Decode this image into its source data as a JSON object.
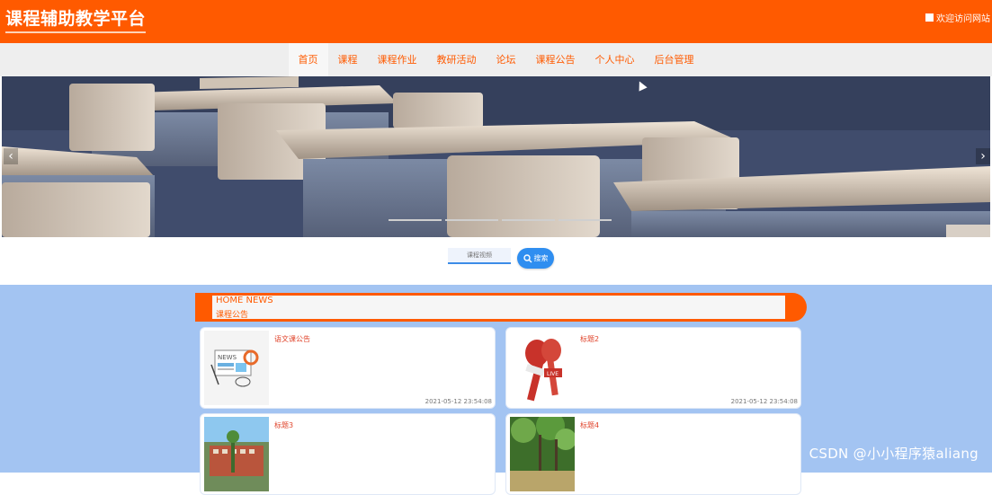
{
  "header": {
    "title": "课程辅助教学平台",
    "welcome": "欢迎访问网站"
  },
  "nav": {
    "items": [
      "首页",
      "课程",
      "课程作业",
      "教研活动",
      "论坛",
      "课程公告",
      "个人中心",
      "后台管理"
    ],
    "active": "首页"
  },
  "banner": {
    "prev_icon": "chevron-left-icon",
    "next_icon": "chevron-right-icon",
    "slides": 4
  },
  "search": {
    "placeholder": "课程视频",
    "button_label": "搜索"
  },
  "news": {
    "heading_en": "HOME NEWS",
    "heading_cn": "课程公告",
    "items": [
      {
        "title": "语文课公告",
        "date": "2021-05-12 23:54:08",
        "thumb": "news-icon"
      },
      {
        "title": "标题2",
        "date": "2021-05-12 23:54:08",
        "thumb": "microphone-icon"
      },
      {
        "title": "标题3",
        "date": "",
        "thumb": "building-photo"
      },
      {
        "title": "标题4",
        "date": "",
        "thumb": "park-photo"
      }
    ]
  },
  "watermark": "CSDN @小小程序猿aliang",
  "colors": {
    "accent": "#ff5a00",
    "content_bg": "#a3c4f2",
    "search_button": "#2f8ef0"
  }
}
